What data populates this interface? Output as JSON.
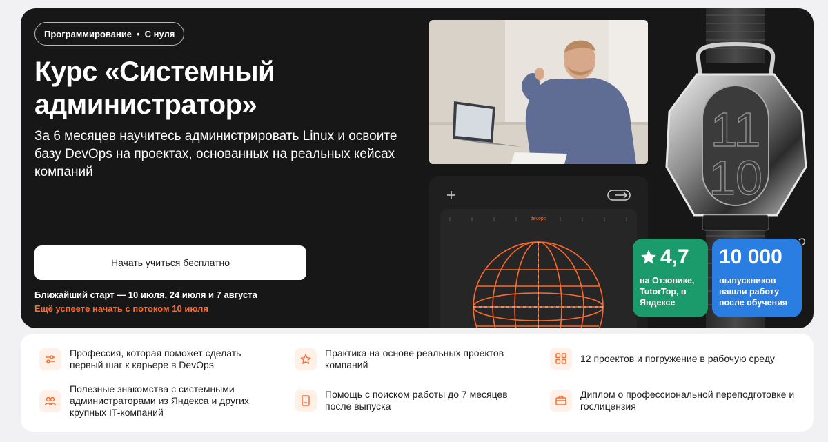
{
  "hero": {
    "tag": {
      "category": "Программирование",
      "separator": "•",
      "level": "С нуля"
    },
    "title": "Курс «Системный администратор»",
    "subtitle": "За 6 месяцев научитесь администрировать Linux и освоите базу DevOps на проектах, основанных на реальных кейсах компаний",
    "cta_label": "Начать учиться бесплатно",
    "start_info": "Ближайший старт — 10 июля, 24 июля и 7 августа",
    "start_accent": "Ещё успеете начать с потоком 10 июля",
    "tablet_label": "devops",
    "watch_digits": [
      "11",
      "10"
    ]
  },
  "badges": {
    "rating": {
      "value": "4,7",
      "text": "на Отзовике, TutorTop, в Яндексе"
    },
    "graduates": {
      "value": "10 000",
      "text": "выпускников нашли работу после обучения"
    }
  },
  "features": [
    {
      "icon": "sliders-icon",
      "text": "Профессия, которая поможет сделать первый шаг к карьере в DevOps"
    },
    {
      "icon": "star-icon",
      "text": "Практика на основе реальных проектов компаний"
    },
    {
      "icon": "grid-icon",
      "text": "12 проектов и погружение в рабочую среду"
    },
    {
      "icon": "people-icon",
      "text": "Полезные знакомства с системными администраторами из Яндекса и других крупных IT-компаний"
    },
    {
      "icon": "book-icon",
      "text": "Помощь с поиском работы до 7 месяцев после выпуска"
    },
    {
      "icon": "briefcase-icon",
      "text": "Диплом о профессиональной переподготовке и гослицензия"
    }
  ],
  "colors": {
    "hero_bg": "#171717",
    "accent": "#ff6a2b",
    "rating_badge": "#1b9b6b",
    "graduates_badge": "#2a7de1",
    "icon_bg": "#fff1e8"
  }
}
